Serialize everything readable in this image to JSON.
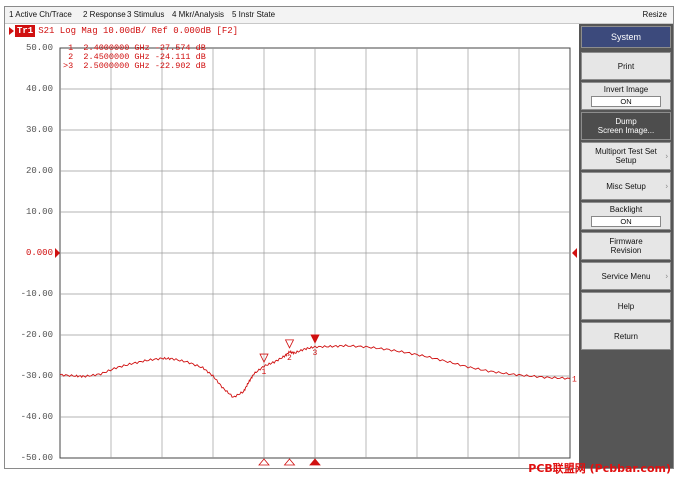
{
  "menubar": {
    "items": [
      "1 Active Ch/Trace",
      "2 Response",
      "3 Stimulus",
      "4 Mkr/Analysis",
      "5 Instr State"
    ],
    "resize": "Resize"
  },
  "trace": {
    "badge": "Tr1",
    "header": "S21 Log Mag 10.00dB/ Ref 0.000dB [F2]",
    "color": "#d01010"
  },
  "markers": [
    {
      "id": "1",
      "prefix": " 1",
      "freq": "2.4000000 GHz",
      "value": "-27.574 dB"
    },
    {
      "id": "2",
      "prefix": " 2",
      "freq": "2.4500000 GHz",
      "value": "-24.111 dB"
    },
    {
      "id": "3",
      "prefix": ">3",
      "freq": "2.5000000 GHz",
      "value": "-22.902 dB"
    }
  ],
  "axis": {
    "labels": [
      "50.00",
      "40.00",
      "30.00",
      "20.00",
      "10.00",
      "0.000",
      "-10.00",
      "-20.00",
      "-30.00",
      "-40.00",
      "-50.00"
    ],
    "ref_label": "0.000",
    "trace_end_label": "1"
  },
  "softkeys": {
    "title": "System",
    "print": "Print",
    "invert_image": "Invert Image",
    "invert_image_value": "ON",
    "dump_line1": "Dump",
    "dump_line2": "Screen Image...",
    "multiport_line1": "Multiport Test Set",
    "multiport_line2": "Setup",
    "misc_setup": "Misc Setup",
    "backlight": "Backlight",
    "backlight_value": "ON",
    "firmware_line1": "Firmware",
    "firmware_line2": "Revision",
    "service_menu": "Service Menu",
    "help": "Help",
    "return": "Return"
  },
  "watermark": "PCB联盟网 (Pcbbar.com)",
  "chart_data": {
    "type": "line",
    "title": "S21 Log Mag 10.00dB/ Ref 0.000dB [F2]",
    "ylim": [
      -50,
      50
    ],
    "xlim": [
      2.0,
      3.0
    ],
    "x_unit": "GHz",
    "y_unit": "dB",
    "grid": true,
    "series": [
      {
        "name": "S21",
        "x": [
          2.0,
          2.03,
          2.05,
          2.08,
          2.11,
          2.14,
          2.17,
          2.2,
          2.22,
          2.25,
          2.28,
          2.3,
          2.32,
          2.34,
          2.36,
          2.37,
          2.38,
          2.4,
          2.42,
          2.44,
          2.45,
          2.46,
          2.48,
          2.5,
          2.53,
          2.56,
          2.6,
          2.64,
          2.68,
          2.72,
          2.76,
          2.8,
          2.84,
          2.88,
          2.92,
          2.96,
          3.0
        ],
        "y": [
          -29.7,
          -30.0,
          -30.1,
          -29.5,
          -28.0,
          -27.0,
          -26.2,
          -25.7,
          -25.8,
          -26.6,
          -28.0,
          -30.0,
          -33.0,
          -35.2,
          -33.8,
          -31.5,
          -29.5,
          -27.6,
          -26.6,
          -25.2,
          -24.1,
          -24.4,
          -23.4,
          -22.9,
          -22.8,
          -22.6,
          -22.9,
          -23.5,
          -24.3,
          -25.3,
          -26.5,
          -27.8,
          -28.8,
          -29.5,
          -30.0,
          -30.4,
          -30.6
        ]
      }
    ],
    "marker_points": [
      {
        "label": "1",
        "x": 2.4,
        "y": -27.574
      },
      {
        "label": "2",
        "x": 2.45,
        "y": -24.111
      },
      {
        "label": "3",
        "x": 2.5,
        "y": -22.902
      }
    ]
  }
}
